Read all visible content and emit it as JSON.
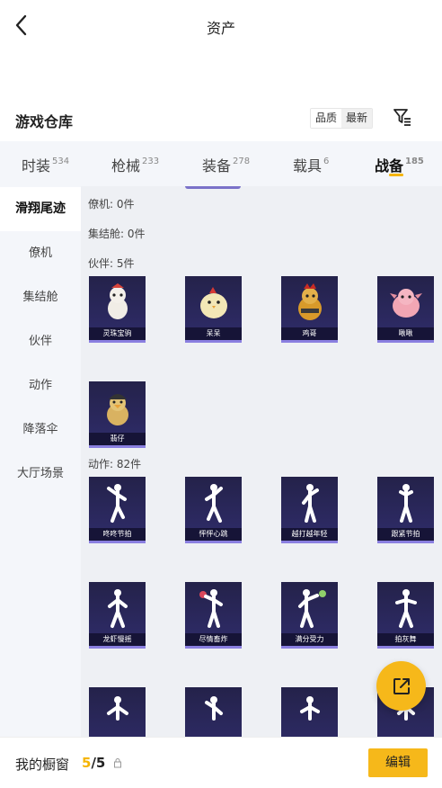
{
  "header": {
    "title": "资产"
  },
  "warehouse": {
    "title": "游戏仓库",
    "sort_options": [
      "品质",
      "最新"
    ]
  },
  "tabs": [
    {
      "label": "时装",
      "count": "534"
    },
    {
      "label": "枪械",
      "count": "233"
    },
    {
      "label": "装备",
      "count": "278"
    },
    {
      "label": "载具",
      "count": "6"
    },
    {
      "label": "战备",
      "count": "185"
    }
  ],
  "sidebar": {
    "items": [
      "滑翔尾迹",
      "僚机",
      "集结舱",
      "伙伴",
      "动作",
      "降落伞",
      "大厅场景"
    ]
  },
  "groups": {
    "wingman": "僚机: 0件",
    "capsule": "集结舱: 0件",
    "partner": "伙伴: 5件",
    "action": "动作: 82件"
  },
  "partners": [
    "灵珠宝驹",
    "呆呆",
    "鸡哥",
    "啾啾",
    "翡仔"
  ],
  "actions": [
    "咚咚节拍",
    "怦怦心跳",
    "越打越年轻",
    "跟紧节拍",
    "龙虾慢摇",
    "尽情畜炸",
    "满分受力",
    "拍灰舞"
  ],
  "bottom": {
    "label": "我的橱窗",
    "count_current": "5",
    "count_total": "/5",
    "edit_label": "编辑"
  },
  "colors": {
    "accent": "#f6b81a",
    "card_bg": "#2a2858",
    "card_border": "#8a7fe0"
  }
}
